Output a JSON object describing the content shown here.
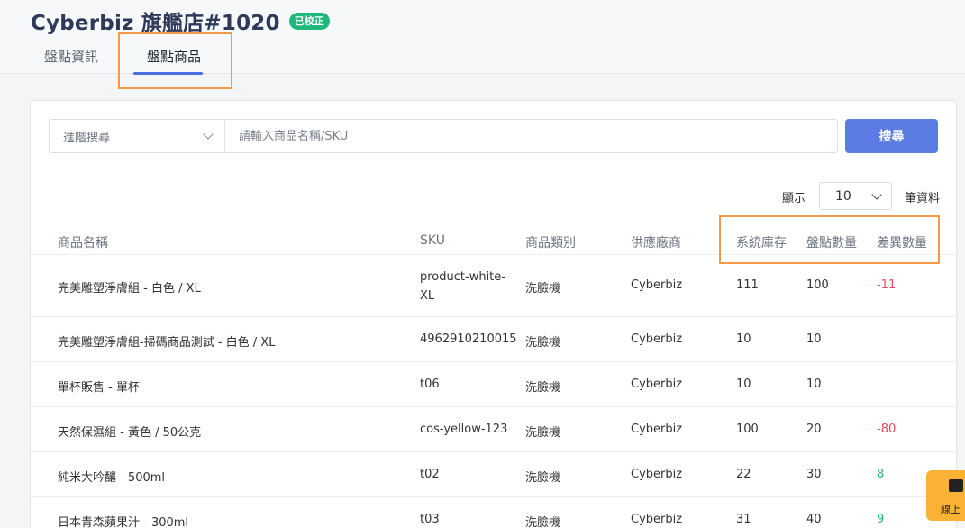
{
  "header": {
    "title": "Cyberbiz 旗艦店#1020",
    "status_badge": "已校正",
    "tabs": [
      {
        "label": "盤點資訊",
        "active": false
      },
      {
        "label": "盤點商品",
        "active": true
      }
    ]
  },
  "search": {
    "advanced_label": "進階搜尋",
    "placeholder": "請輸入商品名稱/SKU",
    "value": "",
    "button_label": "搜尋"
  },
  "pagination": {
    "show_label": "顯示",
    "page_size": "10",
    "records_label": "筆資料"
  },
  "table": {
    "headers": [
      "商品名稱",
      "SKU",
      "商品類別",
      "供應廠商",
      "系統庫存",
      "盤點數量",
      "差異數量"
    ],
    "rows": [
      {
        "name": "完美雕塑淨膚組 - 白色 / XL",
        "sku": "product-white-XL",
        "category": "洗臉機",
        "vendor": "Cyberbiz",
        "system_stock": "111",
        "counted": "100",
        "diff": "-11"
      },
      {
        "name": "完美雕塑淨膚組-掃碼商品測試 - 白色 / XL",
        "sku": "4962910210015",
        "category": "洗臉機",
        "vendor": "Cyberbiz",
        "system_stock": "10",
        "counted": "10",
        "diff": ""
      },
      {
        "name": "單杯販售 - 單杯",
        "sku": "t06",
        "category": "洗臉機",
        "vendor": "Cyberbiz",
        "system_stock": "10",
        "counted": "10",
        "diff": ""
      },
      {
        "name": "天然保濕組 - 黃色 / 50公克",
        "sku": "cos-yellow-123",
        "category": "洗臉機",
        "vendor": "Cyberbiz",
        "system_stock": "100",
        "counted": "20",
        "diff": "-80"
      },
      {
        "name": "純米大吟釀 - 500ml",
        "sku": "t02",
        "category": "洗臉機",
        "vendor": "Cyberbiz",
        "system_stock": "22",
        "counted": "30",
        "diff": "8"
      },
      {
        "name": "日本青森蘋果汁 - 300ml",
        "sku": "t03",
        "category": "洗臉機",
        "vendor": "Cyberbiz",
        "system_stock": "31",
        "counted": "40",
        "diff": "9"
      }
    ]
  },
  "chat_widget": {
    "label": "線上"
  },
  "colors": {
    "accent": "#5b7ce3",
    "badge": "#1db87a",
    "negative": "#e8485d",
    "positive": "#22b576",
    "highlight": "#f39a4a",
    "chat": "#f9b233"
  }
}
